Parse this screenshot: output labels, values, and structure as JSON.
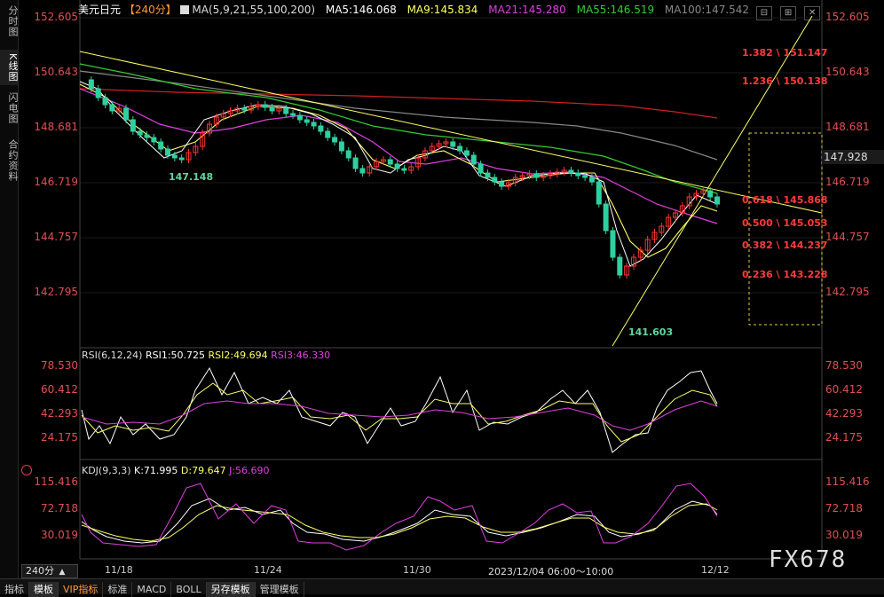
{
  "sidebar": {
    "tabs": [
      "分时图",
      "K线图",
      "闪电图",
      "合约资料"
    ]
  },
  "header": {
    "symbol": "美元日元",
    "period": "【240分】",
    "ma_label": "MA(5,9,21,55,100,200)",
    "ma5": "MA5:146.068",
    "ma9": "MA9:145.834",
    "ma21": "MA21:145.280",
    "ma55": "MA55:146.519",
    "ma100": "MA100:147.542"
  },
  "window_buttons": [
    "⊟",
    "⊞",
    "✕"
  ],
  "main_axis": {
    "ticks": [
      "152.605",
      "150.643",
      "148.681",
      "146.719",
      "144.757",
      "142.795"
    ]
  },
  "current_price": "147.928",
  "annotations": {
    "low_label_1": "147.148",
    "low_label_2": "141.603"
  },
  "fib_levels": [
    {
      "text": "1.382 \\ 151.147"
    },
    {
      "text": "1.236 \\ 150.138"
    },
    {
      "text": "0.618 \\ 145.868"
    },
    {
      "text": "0.500 \\ 145.053"
    },
    {
      "text": "0.382 \\ 144.237"
    },
    {
      "text": "0.236 \\ 143.228"
    }
  ],
  "rsi": {
    "label": "RSI(6,12,24)",
    "rsi1": "RSI1:50.725",
    "rsi2": "RSI2:49.694",
    "rsi3": "RSI3:46.330",
    "ticks": [
      "78.530",
      "60.412",
      "42.293",
      "24.175"
    ]
  },
  "kdj": {
    "label": "KDJ(9,3,3)",
    "k": "K:71.995",
    "d": "D:79.647",
    "j": "J:56.690",
    "ticks": [
      "115.416",
      "72.718",
      "30.019"
    ]
  },
  "period_selector": "240分",
  "x_dates": [
    "11/18",
    "11/24",
    "11/30",
    "2023/12/04 06:00～10:00",
    "12/12"
  ],
  "bottom_tabs": [
    "指标",
    "模板",
    "VIP指标",
    "标准",
    "MACD",
    "BOLL",
    "另存模板",
    "管理模板"
  ],
  "watermark": "FX678",
  "colors": {
    "up": "#ff3333",
    "down": "#2fd0a0",
    "ma5": "#ffffff",
    "ma9": "#ffff66",
    "ma21": "#e040e0",
    "ma55": "#33cc33",
    "ma100": "#888888",
    "ma200": "#d02020"
  }
}
